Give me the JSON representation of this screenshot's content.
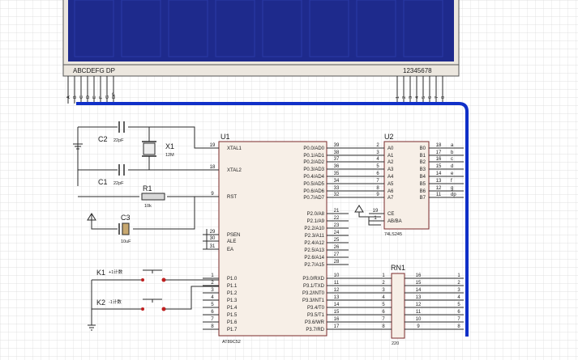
{
  "lcd": {
    "left_label": "ABCDEFG  DP",
    "right_label": "12345678",
    "left_pins": [
      "A",
      "B",
      "C",
      "D",
      "E",
      "F",
      "G",
      "DP"
    ],
    "right_pins": [
      "1",
      "2",
      "3",
      "4",
      "5",
      "6",
      "7",
      "8"
    ]
  },
  "u1": {
    "ref": "U1",
    "part": "AT89C52",
    "left_pins": [
      {
        "num": "19",
        "name": "XTAL1"
      },
      {
        "num": "18",
        "name": "XTAL2"
      },
      {
        "num": "9",
        "name": "RST"
      },
      {
        "num": "29",
        "name": "PSEN"
      },
      {
        "num": "30",
        "name": "ALE"
      },
      {
        "num": "31",
        "name": "EA"
      },
      {
        "num": "1",
        "name": "P1.0"
      },
      {
        "num": "2",
        "name": "P1.1"
      },
      {
        "num": "3",
        "name": "P1.2"
      },
      {
        "num": "4",
        "name": "P1.3"
      },
      {
        "num": "5",
        "name": "P1.4"
      },
      {
        "num": "6",
        "name": "P1.5"
      },
      {
        "num": "7",
        "name": "P1.6"
      },
      {
        "num": "8",
        "name": "P1.7"
      }
    ],
    "right_p0": [
      {
        "num": "39",
        "name": "P0.0/AD0"
      },
      {
        "num": "38",
        "name": "P0.1/AD1"
      },
      {
        "num": "37",
        "name": "P0.2/AD2"
      },
      {
        "num": "36",
        "name": "P0.3/AD3"
      },
      {
        "num": "35",
        "name": "P0.4/AD4"
      },
      {
        "num": "34",
        "name": "P0.5/AD5"
      },
      {
        "num": "33",
        "name": "P0.6/AD6"
      },
      {
        "num": "32",
        "name": "P0.7/AD7"
      }
    ],
    "right_p2": [
      {
        "num": "21",
        "name": "P2.0/A8"
      },
      {
        "num": "22",
        "name": "P2.1/A9"
      },
      {
        "num": "23",
        "name": "P2.2/A10"
      },
      {
        "num": "24",
        "name": "P2.3/A11"
      },
      {
        "num": "25",
        "name": "P2.4/A12"
      },
      {
        "num": "26",
        "name": "P2.5/A13"
      },
      {
        "num": "27",
        "name": "P2.6/A14"
      },
      {
        "num": "28",
        "name": "P2.7/A15"
      }
    ],
    "right_p3": [
      {
        "num": "10",
        "name": "P3.0/RXD"
      },
      {
        "num": "11",
        "name": "P3.1/TXD"
      },
      {
        "num": "12",
        "name": "P3.2/INT0"
      },
      {
        "num": "13",
        "name": "P3.3/INT1"
      },
      {
        "num": "14",
        "name": "P3.4/T0"
      },
      {
        "num": "15",
        "name": "P3.5/T1"
      },
      {
        "num": "16",
        "name": "P3.6/WR"
      },
      {
        "num": "17",
        "name": "P3.7/RD"
      }
    ]
  },
  "u2": {
    "ref": "U2",
    "part": "74LS245",
    "a_pins": [
      {
        "num": "2",
        "name": "A0"
      },
      {
        "num": "3",
        "name": "A1"
      },
      {
        "num": "4",
        "name": "A2"
      },
      {
        "num": "5",
        "name": "A3"
      },
      {
        "num": "6",
        "name": "A4"
      },
      {
        "num": "7",
        "name": "A5"
      },
      {
        "num": "8",
        "name": "A6"
      },
      {
        "num": "9",
        "name": "A7"
      }
    ],
    "b_pins": [
      {
        "num": "18",
        "name": "B0",
        "net": "a"
      },
      {
        "num": "17",
        "name": "B1",
        "net": "b"
      },
      {
        "num": "16",
        "name": "B2",
        "net": "c"
      },
      {
        "num": "15",
        "name": "B3",
        "net": "d"
      },
      {
        "num": "14",
        "name": "B4",
        "net": "e"
      },
      {
        "num": "13",
        "name": "B5",
        "net": "f"
      },
      {
        "num": "12",
        "name": "B6",
        "net": "g"
      },
      {
        "num": "11",
        "name": "B7",
        "net": "dp"
      }
    ],
    "ctrl_pins": [
      {
        "num": "19",
        "name": "CE"
      },
      {
        "num": "1",
        "name": "AB/BA"
      }
    ]
  },
  "rn1": {
    "ref": "RN1",
    "value": "220",
    "left_nums": [
      "1",
      "2",
      "3",
      "4",
      "5",
      "6",
      "7",
      "8"
    ],
    "right_nums": [
      "16",
      "15",
      "14",
      "13",
      "12",
      "11",
      "10",
      "9"
    ],
    "out_nets": [
      "1",
      "2",
      "3",
      "4",
      "5",
      "6",
      "7",
      "8"
    ]
  },
  "components": {
    "c2": {
      "ref": "C2",
      "value": "22pF"
    },
    "c1": {
      "ref": "C1",
      "value": "22pF"
    },
    "x1": {
      "ref": "X1",
      "value": "12M"
    },
    "r1": {
      "ref": "R1",
      "value": "10k"
    },
    "c3": {
      "ref": "C3",
      "value": "10uF"
    },
    "k1": {
      "ref": "K1",
      "value": "+1计数"
    },
    "k2": {
      "ref": "K2",
      "value": "-1计数"
    }
  }
}
